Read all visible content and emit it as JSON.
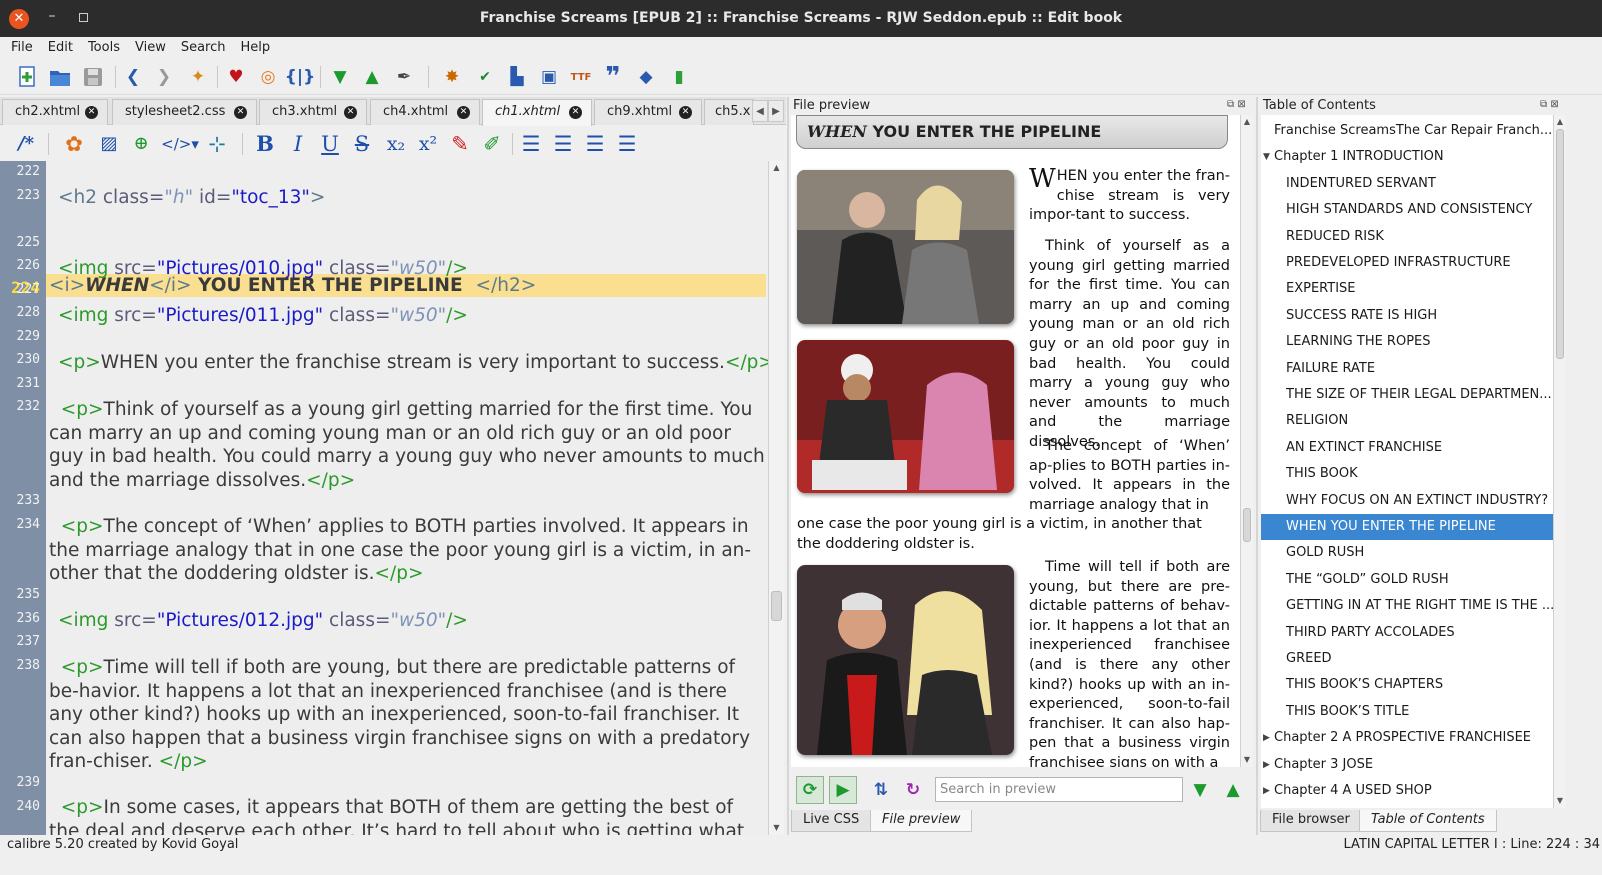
{
  "window": {
    "title": "Franchise Screams [EPUB 2] :: Franchise Screams - RJW Seddon.epub :: Edit book"
  },
  "menu": [
    "File",
    "Edit",
    "Tools",
    "View",
    "Search",
    "Help"
  ],
  "toolbar_icons": [
    "new-file-icon",
    "open-book-icon",
    "save-icon",
    "undo-icon",
    "redo-icon",
    "checkpoint-icon",
    "favorite-icon",
    "lifebuoy-icon",
    "braces-icon",
    "next-arrow-icon",
    "previous-arrow-icon",
    "quill-icon",
    "bug-check-icon",
    "spellcheck-icon",
    "reports-icon",
    "dictionary-icon",
    "fonts-icon",
    "quote-icon",
    "clear-formatting-icon",
    "stats-icon"
  ],
  "tabs": [
    {
      "label": "ch2.xhtml"
    },
    {
      "label": "stylesheet2.css"
    },
    {
      "label": "ch3.xhtml"
    },
    {
      "label": "ch4.xhtml"
    },
    {
      "label": "ch1.xhtml"
    },
    {
      "label": "ch9.xhtml"
    },
    {
      "label": "ch5.x"
    }
  ],
  "format_tools": {
    "comment": "/*",
    "bold": "B",
    "italic": "I",
    "underline": "U",
    "strike": "S",
    "sub": "x₂",
    "sup": "x²"
  },
  "code": {
    "line_numbers": [
      "222",
      "223",
      "224",
      "225",
      "226",
      "227",
      "228",
      "229",
      "230",
      "231",
      "232",
      "233",
      "234",
      "235",
      "236",
      "237",
      "238",
      "239",
      "240"
    ],
    "l223_tag": "<h2 ",
    "l223_a1": "class=",
    "l223_v1": "\"h\"",
    "l223_a2": " id=",
    "l223_v2": "\"toc_13\"",
    "l223_end": ">",
    "l224_i": "<i>",
    "l224_when": "WHEN",
    "l224_ic": "</i>",
    "l224_rest": " YOU ENTER THE PIPELINE  ",
    "l224_close": "</h2>",
    "img_tag": "<img ",
    "src_attr": "src=",
    "img_end": "/>",
    "class_attr": " class=",
    "class_val": "\"w50\"",
    "l226_src": "\"Pictures/010.jpg\"",
    "l228_src": "\"Pictures/011.jpg\"",
    "l236_src": "\"Pictures/012.jpg\"",
    "p_open": "<p>",
    "p_close": "</p>",
    "l230_text": "WHEN you enter the franchise stream is very important to success.",
    "l232_text": "Think of yourself as a young girl getting married for the first time. You can marry an up and coming young man or an old rich guy or an old poor guy in bad health. You could marry a young guy who never amounts to much and the marriage dissolves.",
    "l234_text": "The concept of ‘When’ applies to BOTH parties involved. It appears in the marriage analogy that in one case the poor young girl is a victim, in an-other that the doddering oldster is.",
    "l238_text": "Time will tell if both are young, but there are predictable patterns of be-havior. It happens a lot that an inexperienced franchisee (and is there any other kind?) hooks up with an inexperienced, soon-to-fail franchiser. It can also happen that a business virgin franchisee signs on with a predatory fran-chiser. ",
    "l240_text": "In some cases, it appears that BOTH of them are getting the best of the deal and deserve each other. It’s hard to tell about who is getting what"
  },
  "preview": {
    "label": "File preview",
    "heading_em": "WHEN",
    "heading_rest": " YOU ENTER THE PIPELINE",
    "dropcap": "W",
    "p1": "HEN you enter the fran-chise stream is very impor-tant to success.",
    "p2": "Think of yourself as a young girl getting married for the first time. You can marry an up and coming young man or an old rich guy or an old poor guy in bad health. You could marry a young guy who never amounts to much and the marriage dissolves.",
    "p3a": "The concept of ‘When’ ap-plies to BOTH parties in-volved. It appears in the marriage analogy that in",
    "p3b": "one case the poor young girl is a victim, in another that the doddering oldster is.",
    "p4": "Time will tell if both are young, but there are pre-dictable patterns of behav-ior. It happens a lot that an inexperienced franchisee (and is there any other kind?) hooks up with an in-experienced, soon-to-fail franchiser. It can also hap-pen that a business virgin franchisee signs on with a",
    "search_placeholder": "Search in preview",
    "bottom_tabs": [
      "Live CSS",
      "File preview"
    ]
  },
  "toc": {
    "label": "Table of Contents",
    "items": [
      {
        "label": "Franchise ScreamsThe Car Repair Franch...",
        "level": 1
      },
      {
        "label": "Chapter 1 INTRODUCTION",
        "level": 1,
        "expanded": true
      },
      {
        "label": "INDENTURED SERVANT",
        "level": 2
      },
      {
        "label": "HIGH STANDARDS AND CONSISTENCY",
        "level": 2
      },
      {
        "label": "REDUCED RISK",
        "level": 2
      },
      {
        "label": "PREDEVELOPED INFRASTRUCTURE",
        "level": 2
      },
      {
        "label": "EXPERTISE",
        "level": 2
      },
      {
        "label": "SUCCESS RATE IS HIGH",
        "level": 2
      },
      {
        "label": "LEARNING THE ROPES",
        "level": 2
      },
      {
        "label": "FAILURE RATE",
        "level": 2
      },
      {
        "label": "THE SIZE OF THEIR LEGAL DEPARTMEN...",
        "level": 2
      },
      {
        "label": "RELIGION",
        "level": 2
      },
      {
        "label": "AN EXTINCT FRANCHISE",
        "level": 2
      },
      {
        "label": "THIS BOOK",
        "level": 2
      },
      {
        "label": "WHY FOCUS ON AN EXTINCT INDUSTRY?",
        "level": 2
      },
      {
        "label": "WHEN YOU ENTER THE PIPELINE",
        "level": 2,
        "selected": true
      },
      {
        "label": "GOLD RUSH",
        "level": 2
      },
      {
        "label": "THE “GOLD” GOLD RUSH",
        "level": 2
      },
      {
        "label": "GETTING IN AT THE RIGHT TIME IS THE ...",
        "level": 2
      },
      {
        "label": "THIRD PARTY ACCOLADES",
        "level": 2
      },
      {
        "label": "GREED",
        "level": 2
      },
      {
        "label": "THIS BOOK’S CHAPTERS",
        "level": 2
      },
      {
        "label": "THIS BOOK’S TITLE",
        "level": 2
      },
      {
        "label": "Chapter 2 A PROSPECTIVE FRANCHISEE",
        "level": 1,
        "expanded": false
      },
      {
        "label": "Chapter 3 JOSE",
        "level": 1,
        "expanded": false
      },
      {
        "label": "Chapter 4 A USED SHOP",
        "level": 1,
        "expanded": false
      }
    ],
    "bottom_tabs": [
      "File browser",
      "Table of Contents"
    ]
  },
  "status": {
    "left": "calibre 5.20 created by Kovid Goyal",
    "right": "LATIN CAPITAL LETTER I : Line: 224 : 34"
  },
  "colors": {
    "selection": "#3a86d0",
    "current_line": "#fadf90",
    "gutter": "#7f8fa6",
    "titlebar": "#2c2c2c",
    "close": "#e95420"
  }
}
